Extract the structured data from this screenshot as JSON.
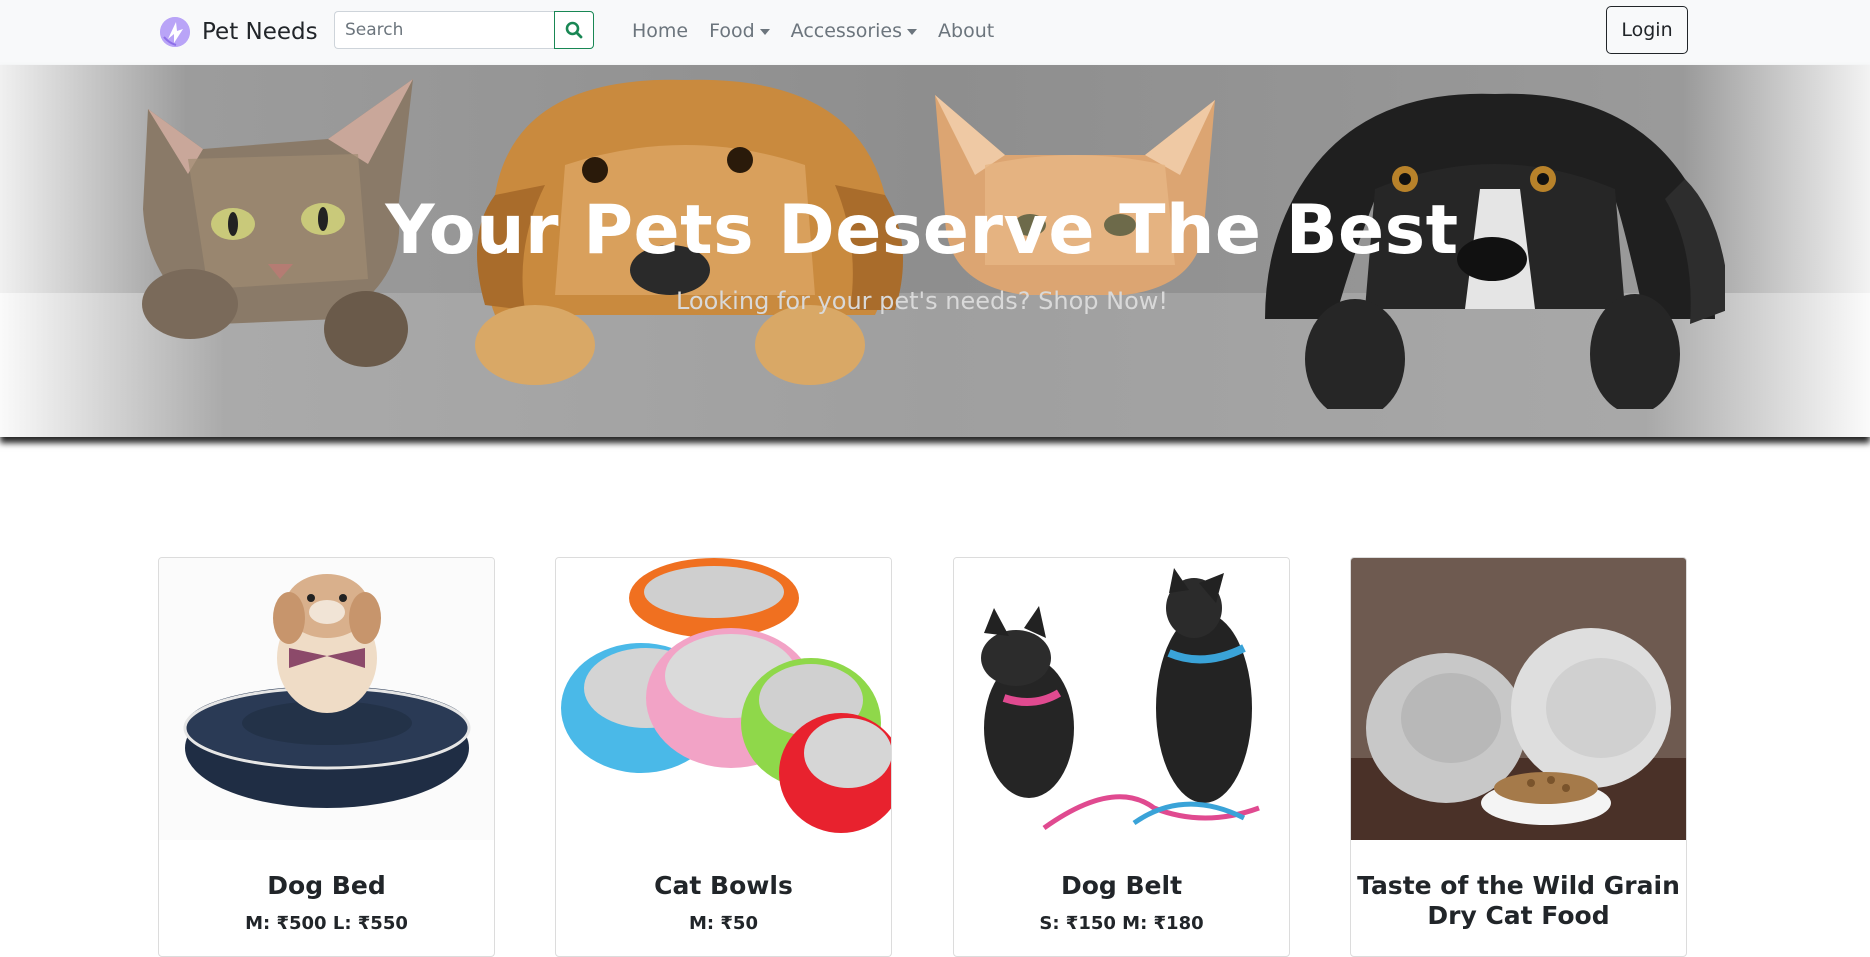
{
  "navbar": {
    "brand": "Pet Needs",
    "search_placeholder": "Search",
    "links": [
      {
        "label": "Home",
        "dropdown": false
      },
      {
        "label": "Food",
        "dropdown": true
      },
      {
        "label": "Accessories",
        "dropdown": true
      },
      {
        "label": "About",
        "dropdown": false
      }
    ],
    "login_label": "Login",
    "search_accent": "#198754"
  },
  "hero": {
    "title": "Your Pets Deserve The Best",
    "subtitle": "Looking for your pet's needs? Shop Now!"
  },
  "products": [
    {
      "name": "Dog Bed",
      "price": "M: ₹500 L: ₹550"
    },
    {
      "name": "Cat Bowls",
      "price": "M: ₹50"
    },
    {
      "name": "Dog Belt",
      "price": "S: ₹150 M: ₹180"
    },
    {
      "name": "Taste of the Wild Grain Dry Cat Food",
      "price": ""
    }
  ]
}
